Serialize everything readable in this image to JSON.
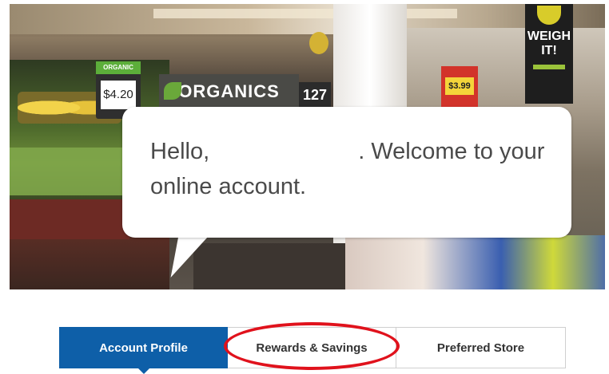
{
  "hero": {
    "signs": {
      "organic_tag": "ORGANIC",
      "price": "$4.20",
      "organics": "ORGANICS",
      "aisle": "127",
      "weigh_line1": "WEIGH",
      "weigh_line2": "IT!",
      "red_sign_price": "$3.99"
    }
  },
  "welcome": {
    "hello": "Hello,",
    "message": ". Welcome to your online account."
  },
  "tabs": [
    {
      "label": "Account Profile",
      "active": true
    },
    {
      "label": "Rewards & Savings",
      "active": false
    },
    {
      "label": "Preferred Store",
      "active": false
    }
  ],
  "colors": {
    "tab_active_bg": "#0e5fa8",
    "annotation": "#e0121c"
  }
}
